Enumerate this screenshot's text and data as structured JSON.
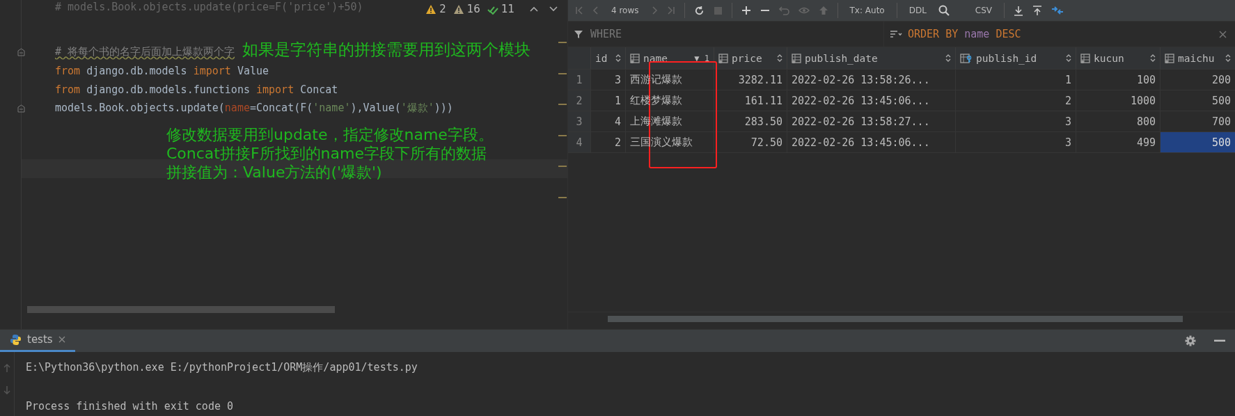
{
  "editor": {
    "cut_line": "# models.Book.objects.update(price=F('price')+50)",
    "inspections": [
      {
        "kind": "warning",
        "count": "2"
      },
      {
        "kind": "weak",
        "count": "16"
      },
      {
        "kind": "typo",
        "count": "11"
      }
    ],
    "code_lines": [
      {
        "fold": true,
        "tokens": [
          {
            "kind": "comment",
            "text": "# 将每个书的名字后面加上爆款两个字"
          }
        ]
      },
      {
        "fold": false,
        "tokens": [
          {
            "kind": "kw",
            "text": "from"
          },
          {
            "kind": "plain",
            "text": " django.db.models "
          },
          {
            "kind": "kw",
            "text": "import"
          },
          {
            "kind": "plain",
            "text": " Value"
          }
        ]
      },
      {
        "fold": false,
        "tokens": [
          {
            "kind": "kw",
            "text": "from"
          },
          {
            "kind": "plain",
            "text": " django.db.models.functions "
          },
          {
            "kind": "kw",
            "text": "import"
          },
          {
            "kind": "plain",
            "text": " Concat"
          }
        ]
      },
      {
        "fold": true,
        "tokens": [
          {
            "kind": "plain",
            "text": "models.Book.objects.update("
          },
          {
            "kind": "param",
            "text": "name"
          },
          {
            "kind": "plain",
            "text": "=Concat(F("
          },
          {
            "kind": "str",
            "text": "'name'"
          },
          {
            "kind": "plain",
            "text": "),Value("
          },
          {
            "kind": "str",
            "text": "'爆款'"
          },
          {
            "kind": "plain",
            "text": "))"
          },
          {
            "kind": "plain",
            "text": ")"
          }
        ]
      }
    ],
    "note_top": "如果是字符串的拼接需要用到这两个模块",
    "note_lines": [
      "修改数据要用到update，指定修改name字段。",
      "Concat拼接F所找到的name字段下所有的数据",
      "拼接值为：Value方法的('爆款')"
    ]
  },
  "grid": {
    "row_count": "4 rows",
    "tx": "Tx: Auto",
    "ddl": "DDL",
    "export": "CSV",
    "where_placeholder": "WHERE",
    "order_by": [
      {
        "kind": "kw",
        "text": "ORDER BY"
      },
      {
        "kind": "col",
        "text": "name"
      },
      {
        "kind": "kw",
        "text": "DESC"
      }
    ],
    "columns": [
      {
        "label": "id",
        "kind": "key"
      },
      {
        "label": "name",
        "kind": "text",
        "sort": "▼ 1"
      },
      {
        "label": "price",
        "kind": "number"
      },
      {
        "label": "publish_date",
        "kind": "text"
      },
      {
        "label": "publish_id",
        "kind": "foreign_key"
      },
      {
        "label": "kucun",
        "kind": "number"
      },
      {
        "label": "maichu",
        "kind": "number"
      }
    ],
    "rows": [
      {
        "num": "1",
        "cells": [
          {
            "text": "3",
            "selected": false
          },
          {
            "text": "西游记爆款",
            "selected": false
          },
          {
            "text": "3282.11",
            "selected": false
          },
          {
            "text": "2022-02-26 13:58:26...",
            "selected": false
          },
          {
            "text": "1",
            "selected": false
          },
          {
            "text": "100",
            "selected": false
          },
          {
            "text": "200",
            "selected": false
          }
        ]
      },
      {
        "num": "2",
        "cells": [
          {
            "text": "1",
            "selected": false
          },
          {
            "text": "红楼梦爆款",
            "selected": false
          },
          {
            "text": "161.11",
            "selected": false
          },
          {
            "text": "2022-02-26 13:45:06...",
            "selected": false
          },
          {
            "text": "2",
            "selected": false
          },
          {
            "text": "1000",
            "selected": false
          },
          {
            "text": "500",
            "selected": false
          }
        ]
      },
      {
        "num": "3",
        "cells": [
          {
            "text": "4",
            "selected": false
          },
          {
            "text": "上海滩爆款",
            "selected": false
          },
          {
            "text": "283.50",
            "selected": false
          },
          {
            "text": "2022-02-26 13:58:27...",
            "selected": false
          },
          {
            "text": "3",
            "selected": false
          },
          {
            "text": "800",
            "selected": false
          },
          {
            "text": "700",
            "selected": false
          }
        ]
      },
      {
        "num": "4",
        "cells": [
          {
            "text": "2",
            "selected": false
          },
          {
            "text": "三国演义爆款",
            "selected": false
          },
          {
            "text": "72.50",
            "selected": false
          },
          {
            "text": "2022-02-26 13:45:06...",
            "selected": false
          },
          {
            "text": "3",
            "selected": false
          },
          {
            "text": "499",
            "selected": false
          },
          {
            "text": "500",
            "selected": true
          }
        ]
      }
    ]
  },
  "run_panel": {
    "tab": "tests",
    "command": "E:\\Python36\\python.exe E:/pythonProject1/ORM操作/app01/tests.py",
    "result": "Process finished with exit code 0"
  }
}
